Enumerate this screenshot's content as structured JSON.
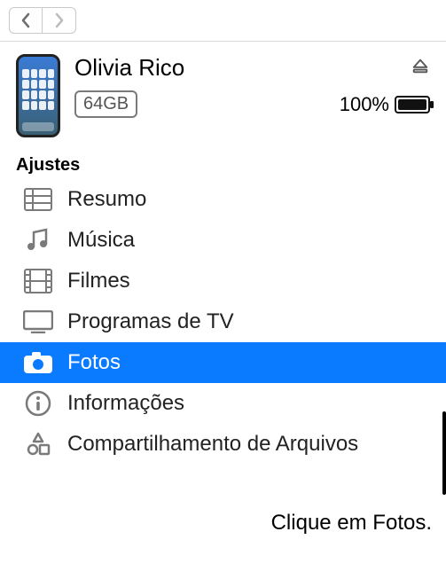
{
  "device": {
    "name": "Olivia Rico",
    "capacity": "64GB",
    "battery_percent_text": "100%",
    "battery_percent": 100
  },
  "section_title": "Ajustes",
  "settings": {
    "items": [
      {
        "id": "summary",
        "label": "Resumo",
        "icon": "list",
        "selected": false
      },
      {
        "id": "music",
        "label": "Música",
        "icon": "music",
        "selected": false
      },
      {
        "id": "movies",
        "label": "Filmes",
        "icon": "film",
        "selected": false
      },
      {
        "id": "tv",
        "label": "Programas de TV",
        "icon": "tv",
        "selected": false
      },
      {
        "id": "photos",
        "label": "Fotos",
        "icon": "camera",
        "selected": true
      },
      {
        "id": "info",
        "label": "Informações",
        "icon": "info",
        "selected": false
      },
      {
        "id": "sharing",
        "label": "Compartilhamento de Arquivos",
        "icon": "apps",
        "selected": false
      }
    ]
  },
  "caption": "Clique em Fotos."
}
